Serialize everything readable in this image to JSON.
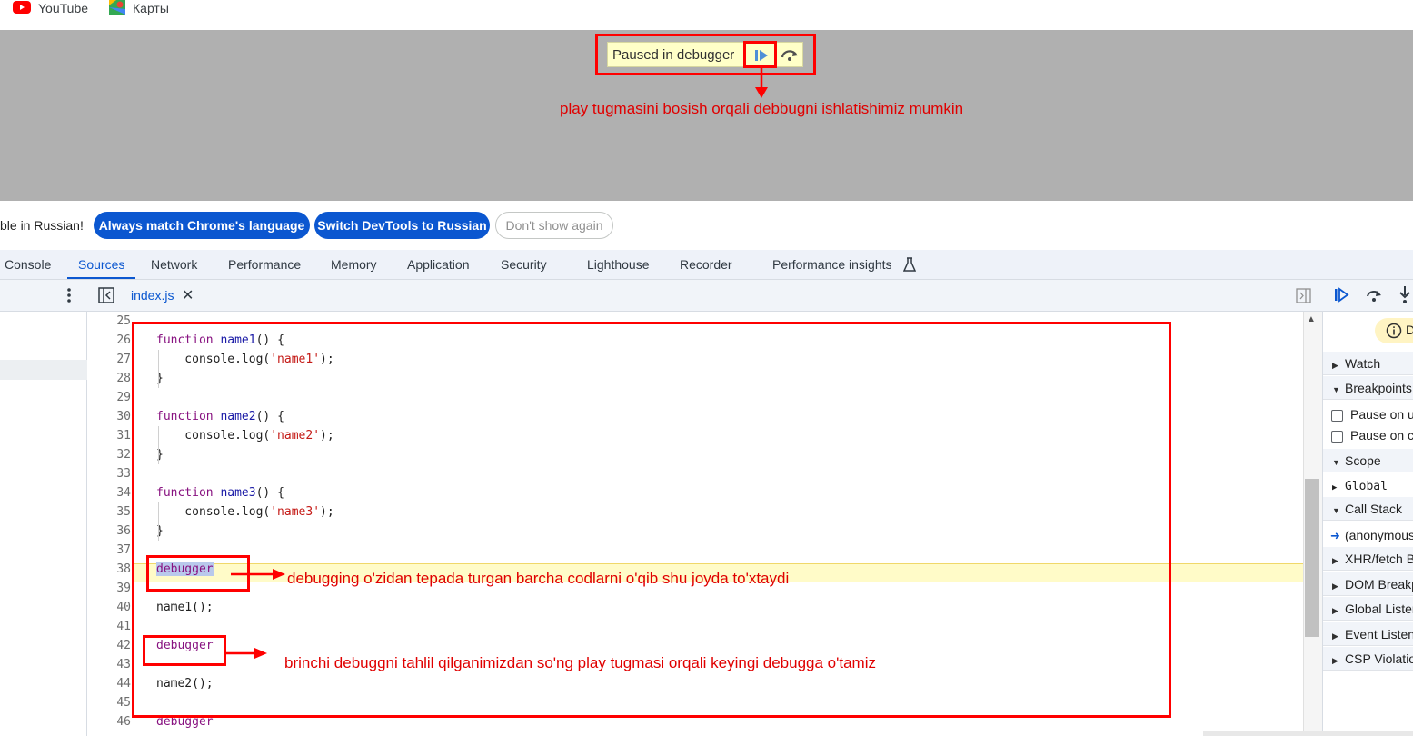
{
  "bookmarks": [
    {
      "label": "YouTube",
      "icon": "youtube-icon"
    },
    {
      "label": "Карты",
      "icon": "maps-icon"
    }
  ],
  "paused_overlay": {
    "label": "Paused in debugger",
    "resume_icon": "resume-icon",
    "step_over_icon": "step-over-icon"
  },
  "infobar": {
    "message": "ble in Russian!",
    "buttons": [
      "Always match Chrome's language",
      "Switch DevTools to Russian",
      "Don't show again"
    ]
  },
  "tabs": [
    "Console",
    "Sources",
    "Network",
    "Performance",
    "Memory",
    "Application",
    "Security",
    "Lighthouse",
    "Recorder",
    "Performance insights"
  ],
  "active_tab": "Sources",
  "editor": {
    "file_tab": "index.js",
    "lines": [
      {
        "n": "25",
        "text": ""
      },
      {
        "n": "26",
        "text": "function name1() {"
      },
      {
        "n": "27",
        "text": "    console.log('name1');"
      },
      {
        "n": "28",
        "text": "}"
      },
      {
        "n": "29",
        "text": ""
      },
      {
        "n": "30",
        "text": "function name2() {"
      },
      {
        "n": "31",
        "text": "    console.log('name2');"
      },
      {
        "n": "32",
        "text": "}"
      },
      {
        "n": "33",
        "text": ""
      },
      {
        "n": "34",
        "text": "function name3() {"
      },
      {
        "n": "35",
        "text": "    console.log('name3');"
      },
      {
        "n": "36",
        "text": "}"
      },
      {
        "n": "37",
        "text": ""
      },
      {
        "n": "38",
        "text": "debugger"
      },
      {
        "n": "39",
        "text": ""
      },
      {
        "n": "40",
        "text": "name1();"
      },
      {
        "n": "41",
        "text": ""
      },
      {
        "n": "42",
        "text": "debugger"
      },
      {
        "n": "43",
        "text": ""
      },
      {
        "n": "44",
        "text": "name2();"
      },
      {
        "n": "45",
        "text": ""
      },
      {
        "n": "46",
        "text": "debugger"
      }
    ],
    "paused_line": "38"
  },
  "debugger_pane": {
    "toolbar_icons": [
      "resume-icon",
      "step-over-icon",
      "step-into-icon"
    ],
    "banner_text": "D",
    "sections": [
      {
        "label": "Watch",
        "expanded": false
      },
      {
        "label": "Breakpoints",
        "expanded": true
      },
      {
        "label": "Scope",
        "expanded": true
      },
      {
        "label": "Call Stack",
        "expanded": true
      },
      {
        "label": "XHR/fetch Breakpoints",
        "expanded": false
      },
      {
        "label": "DOM Breakpoints",
        "expanded": false
      },
      {
        "label": "Global Listeners",
        "expanded": false
      },
      {
        "label": "Event Listener Breakpoints",
        "expanded": false
      },
      {
        "label": "CSP Violation Breakpoints",
        "expanded": false
      }
    ],
    "breakpoint_options": [
      "Pause on uncaught exceptions",
      "Pause on caught exceptions"
    ],
    "scope_items": [
      "Global"
    ],
    "call_stack": [
      "(anonymous)"
    ]
  },
  "annotations": {
    "note1": "play tugmasini bosish orqali debbugni ishlatishimiz mumkin",
    "note2": "debugging o'zidan tepada turgan barcha codlarni o'qib shu joyda to'xtaydi",
    "note3": "brinchi debuggni tahlil qilganimizdan so'ng play tugmasi orqali keyingi debugga o'tamiz"
  },
  "colors": {
    "accent": "#0b57d0",
    "annotation": "#ff0000",
    "paused_line": "#fffbc8"
  }
}
